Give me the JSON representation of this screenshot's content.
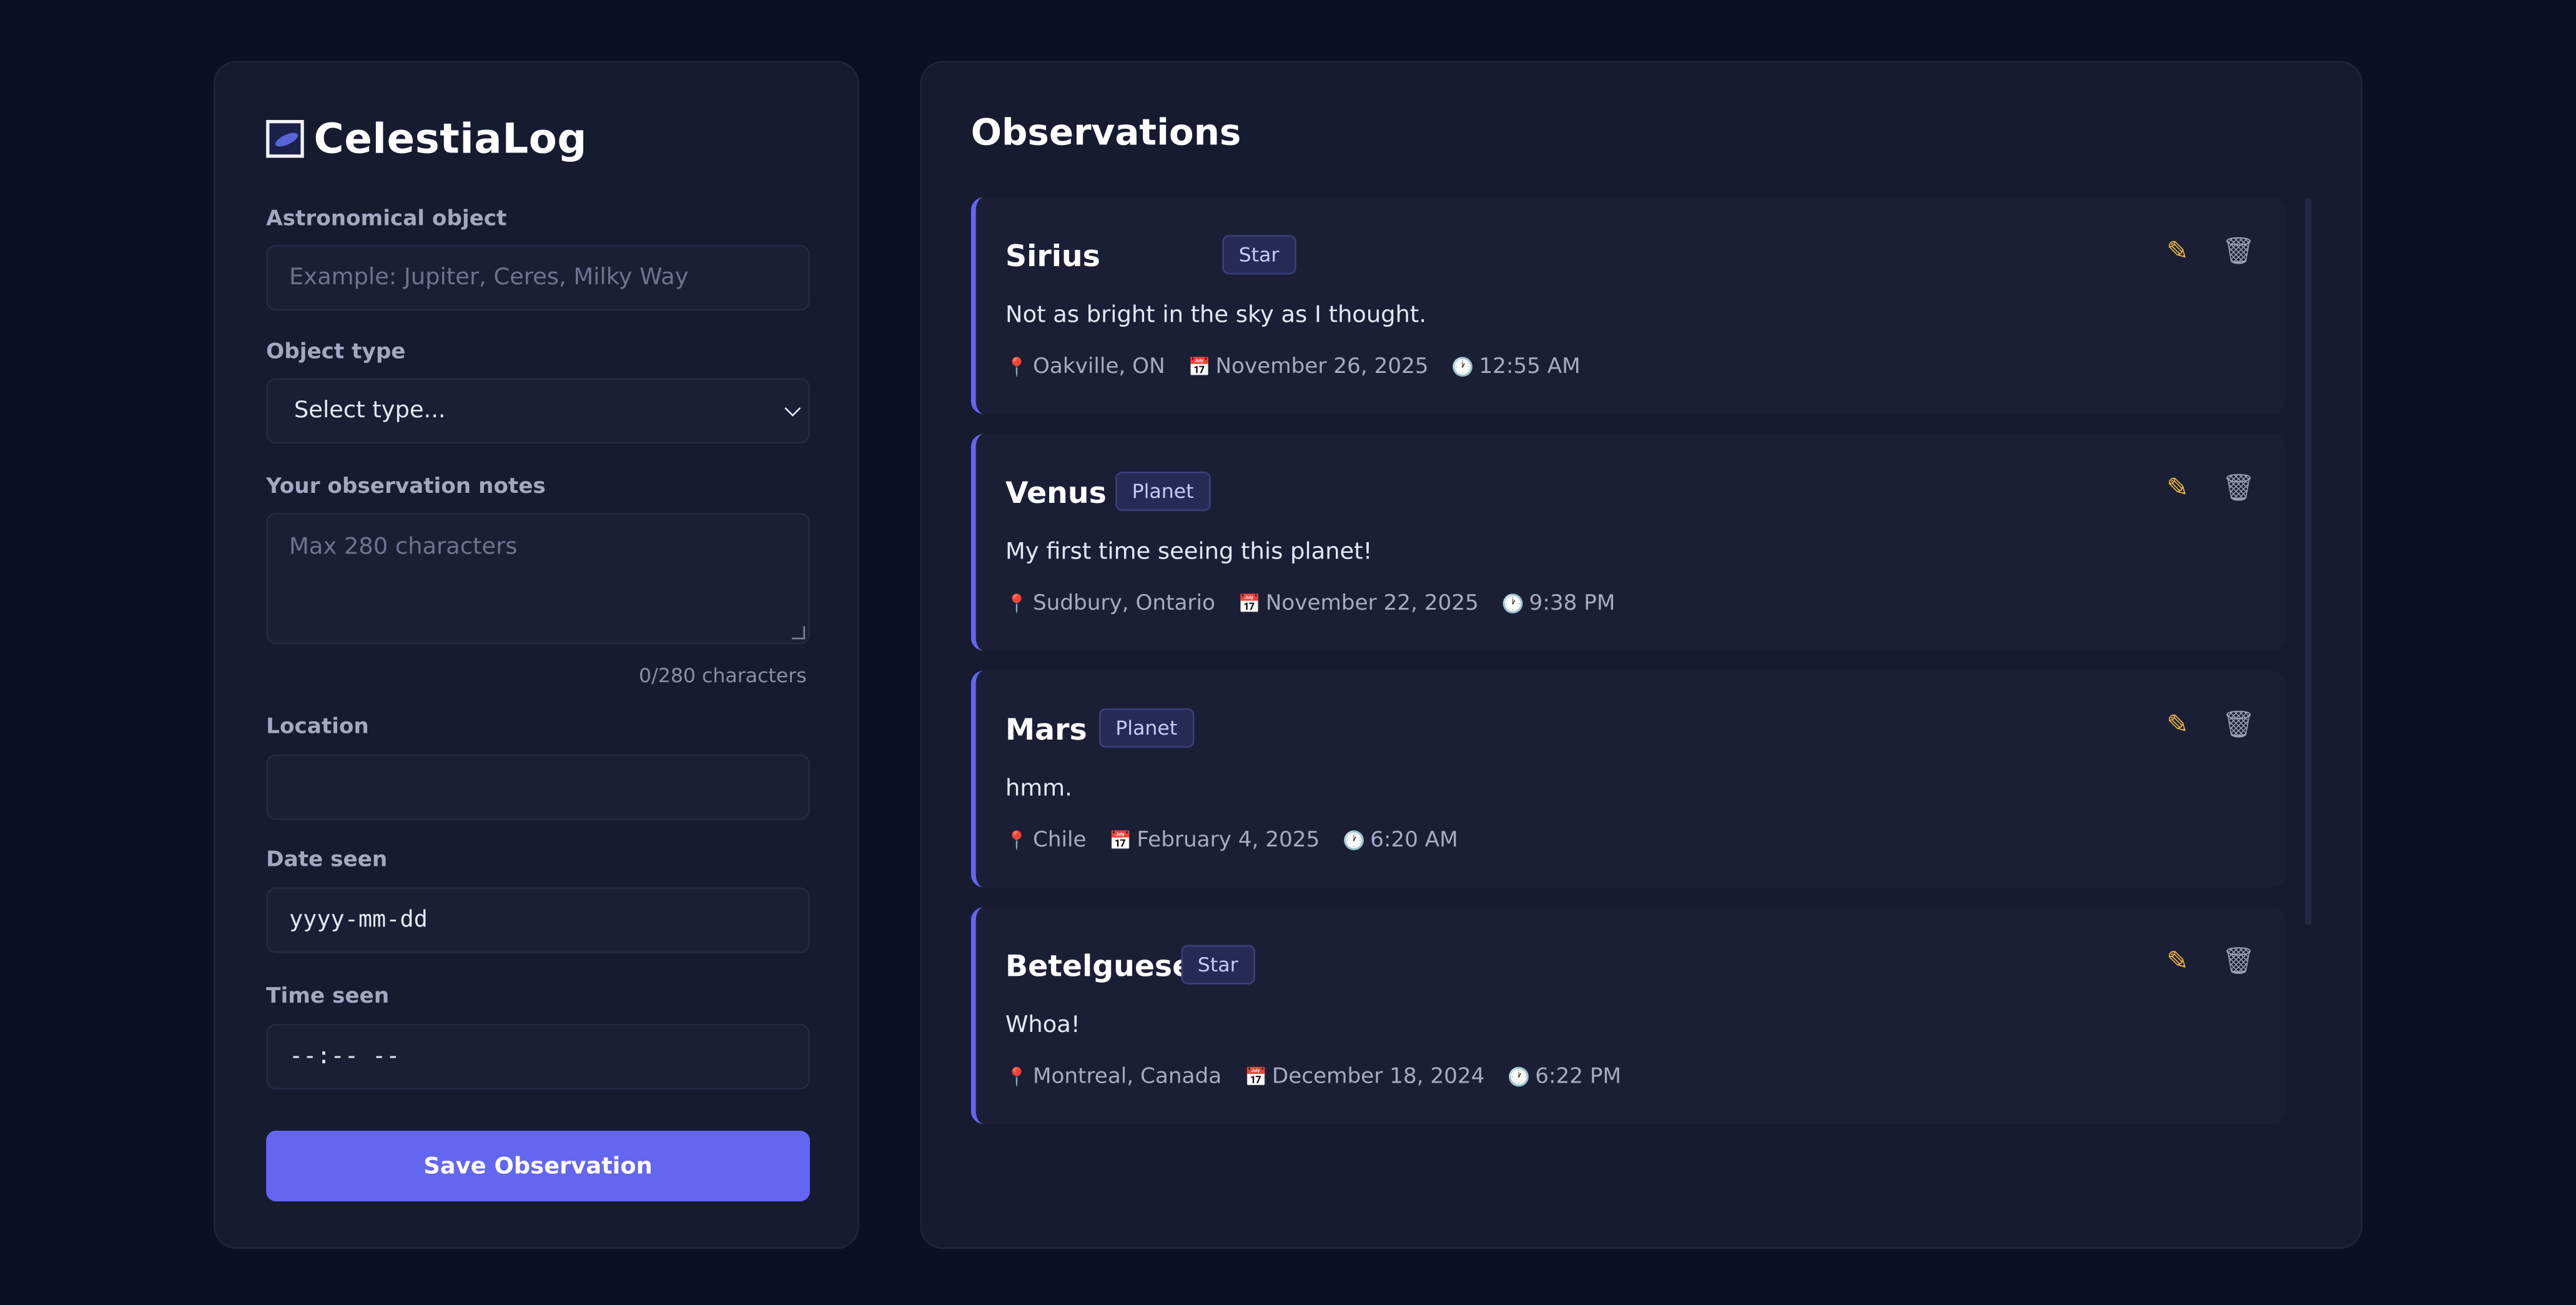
{
  "app": {
    "name": "CelestiaLog",
    "logo_icon": "galaxy-icon"
  },
  "form": {
    "object_label": "Astronomical object",
    "object_placeholder": "Example: Jupiter, Ceres, Milky Way",
    "type_label": "Object type",
    "type_selected": "Select type...",
    "notes_label": "Your observation notes",
    "notes_placeholder": "Max 280 characters",
    "char_count": "0/280 characters",
    "location_label": "Location",
    "location_value": "",
    "date_label": "Date seen",
    "date_value": "yyyy-mm-dd",
    "time_label": "Time seen",
    "time_value": "--:-- --",
    "save_label": "Save Observation"
  },
  "observations": {
    "title": "Observations",
    "items": [
      {
        "name": "Sirius",
        "type": "Star",
        "note": "Not as bright in the sky as I thought.",
        "location": "Oakville, ON",
        "date": "November 26, 2025",
        "time": "12:55 AM"
      },
      {
        "name": "Venus",
        "type": "Planet",
        "note": "My first time seeing this planet!",
        "location": "Sudbury, Ontario",
        "date": "November 22, 2025",
        "time": "9:38 PM"
      },
      {
        "name": "Mars",
        "type": "Planet",
        "note": "hmm.",
        "location": "Chile",
        "date": "February 4, 2025",
        "time": "6:20 AM"
      },
      {
        "name": "Betelguese",
        "type": "Star",
        "note": "Whoa!",
        "location": "Montreal, Canada",
        "date": "December 18, 2024",
        "time": "6:22 PM"
      }
    ]
  },
  "colors": {
    "accent": "#6366f1",
    "background": "#0b1026",
    "panel": "#161b30"
  }
}
